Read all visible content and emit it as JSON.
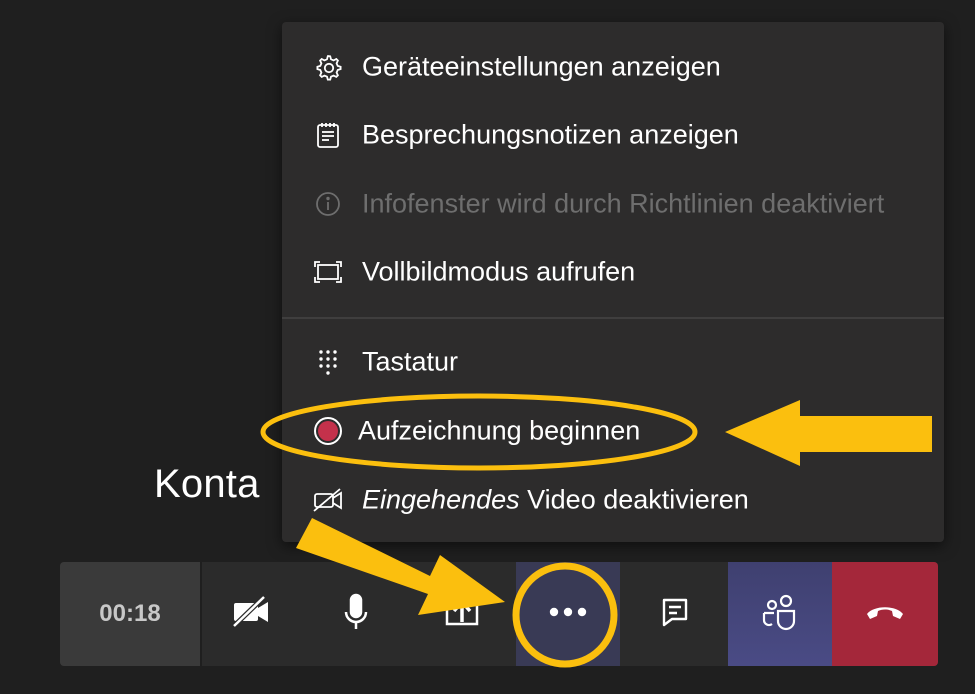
{
  "background": {
    "partial_name": "Konta"
  },
  "menu": {
    "items": [
      {
        "label": "Geräteeinstellungen anzeigen",
        "icon": "gear-icon",
        "enabled": true
      },
      {
        "label": "Besprechungsnotizen anzeigen",
        "icon": "notes-icon",
        "enabled": true
      },
      {
        "label": "Infofenster wird durch Richtlinien deaktiviert",
        "icon": "info-icon",
        "enabled": false
      },
      {
        "label": "Vollbildmodus aufrufen",
        "icon": "fullscreen-icon",
        "enabled": true
      },
      {
        "label": "Tastatur",
        "icon": "keypad-icon",
        "enabled": true
      },
      {
        "label": "Aufzeichnung beginnen",
        "icon": "record-icon",
        "enabled": true
      },
      {
        "label_italic": "Eingehendes",
        "label_rest": " Video deaktivieren",
        "icon": "video-off-icon",
        "enabled": true
      }
    ]
  },
  "toolbar": {
    "timer": "00:18",
    "buttons": [
      "camera-off-icon",
      "microphone-icon",
      "share-screen-icon",
      "more-options-icon",
      "chat-icon",
      "participants-icon",
      "hang-up-icon"
    ]
  },
  "colors": {
    "menu_bg": "#2d2c2c",
    "record_red": "#c4314b",
    "hangup_red": "#a4273a",
    "participants_bg": "#4a4b85",
    "annotation_yellow": "#fbbf0e"
  }
}
